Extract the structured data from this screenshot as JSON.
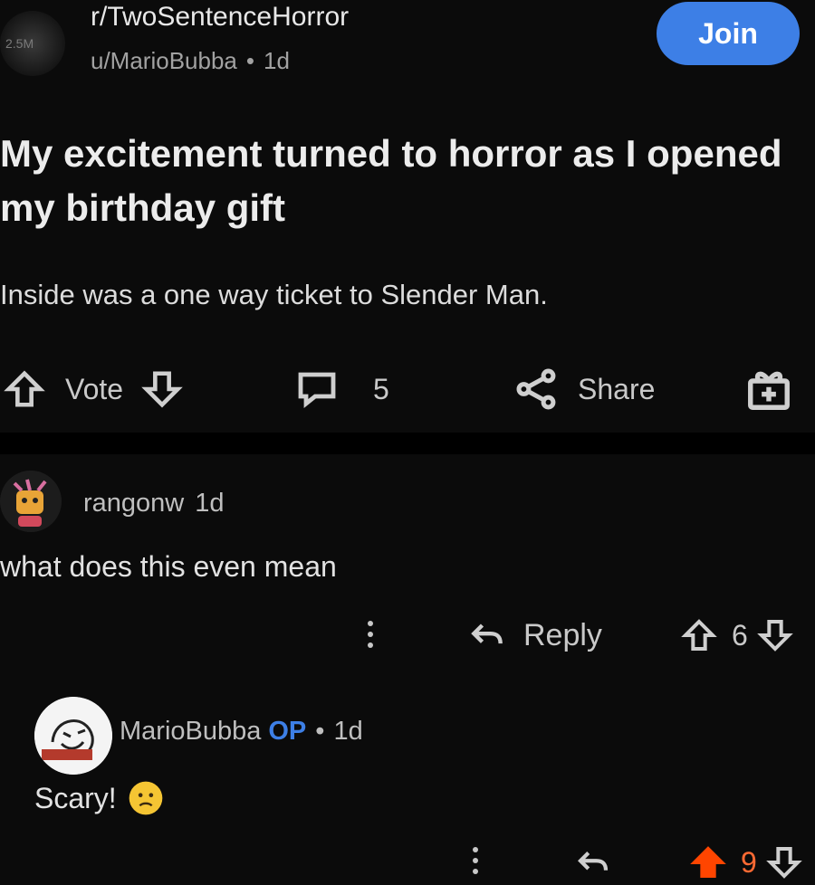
{
  "header": {
    "subreddit": "r/TwoSentenceHorror",
    "author": "u/MarioBubba",
    "time": "1d",
    "avatar_text": "2.5M",
    "join_label": "Join"
  },
  "post": {
    "title": "My excitement turned to horror as I opened my birthday gift",
    "body": "Inside was a one way ticket to Slender Man."
  },
  "actions": {
    "vote_label": "Vote",
    "comment_count": "5",
    "share_label": "Share"
  },
  "comments": [
    {
      "user": "rangonw",
      "time": "1d",
      "text": "what does this even mean",
      "reply_label": "Reply",
      "votes": "6"
    },
    {
      "user": "MarioBubba",
      "op_badge": "OP",
      "time": "1d",
      "text": "Scary!",
      "votes": "9",
      "upvoted": true
    }
  ],
  "colors": {
    "background": "#0b0b0b",
    "accent": "#3d7fe6",
    "upvote": "#ff4500"
  }
}
